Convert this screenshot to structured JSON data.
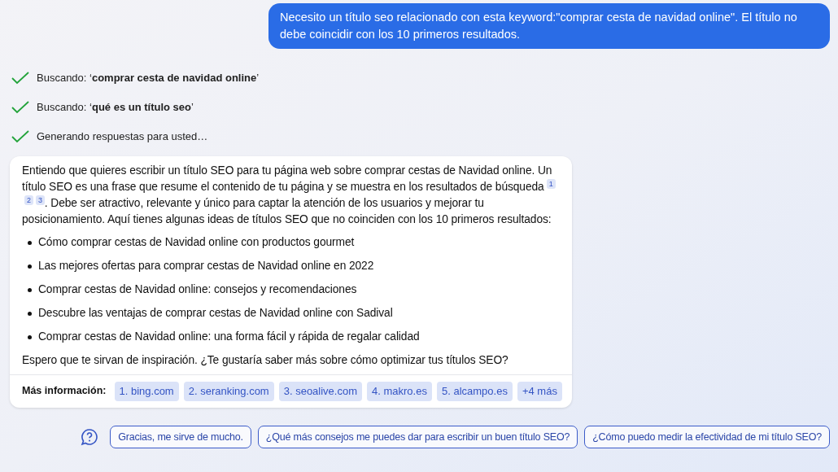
{
  "user_message": "Necesito un título seo relacionado con esta keyword:\"comprar cesta de navidad online\". El título no debe coincidir con los 10 primeros resultados.",
  "progress": [
    {
      "text": "Buscando: ‘**comprar cesta de navidad online**’",
      "done": true
    },
    {
      "text": "Buscando: ‘**qué es un título seo**’",
      "done": true
    },
    {
      "text": "Generando respuestas para usted…",
      "done": true
    }
  ],
  "answer": {
    "text_before": "Entiendo que quieres escribir un título SEO para tu página web sobre comprar cestas de Navidad online. Un título SEO es una frase que resume el contenido de tu página y se muestra en los resultados de búsqueda",
    "citations": [
      "1",
      "2",
      "3"
    ],
    "text_after": ". Debe ser atractivo, relevante y único para captar la atención de los usuarios y mejorar tu posicionamiento. Aquí tienes algunas ideas de títulos SEO que no coinciden con los 10 primeros resultados:",
    "items": [
      "Cómo comprar cestas de Navidad online con productos gourmet",
      "Las mejores ofertas para comprar cestas de Navidad online en 2022",
      "Comprar cestas de Navidad online: consejos y recomendaciones",
      "Descubre las ventajas de comprar cestas de Navidad online con Sadival",
      "Comprar cestas de Navidad online: una forma fácil y rápida de regalar calidad"
    ],
    "closing": "Espero que te sirvan de inspiración. ¿Te gustaría saber más sobre cómo optimizar tus títulos SEO?",
    "sources_label": "Más información:",
    "sources": [
      "1. bing.com",
      "2. seranking.com",
      "3. seoalive.com",
      "4. makro.es",
      "5. alcampo.es",
      "+4 más"
    ]
  },
  "suggestions": [
    "Gracias, me sirve de mucho.",
    "¿Qué más consejos me puedes dar para escribir un buen título SEO?",
    "¿Cómo puedo medir la efectividad de mi título SEO?"
  ]
}
